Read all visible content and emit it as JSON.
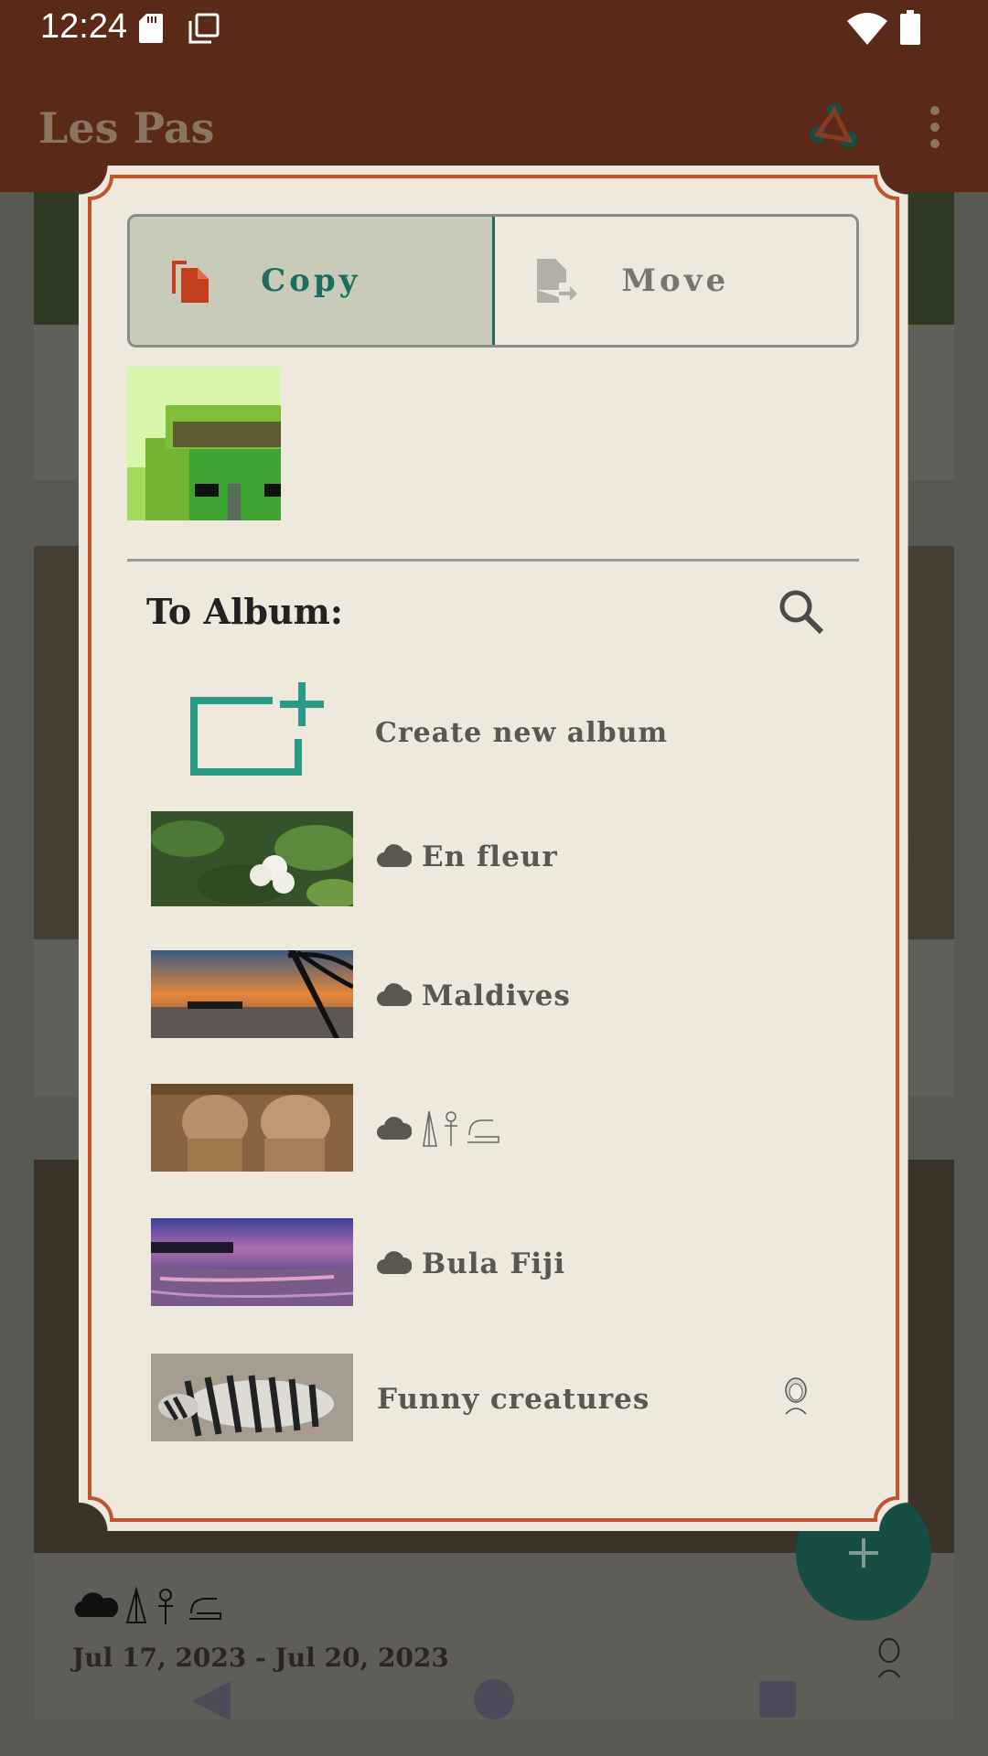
{
  "status_bar": {
    "time": "12:24"
  },
  "app_bar": {
    "title": "Les Pas"
  },
  "background": {
    "date_range": "Jul 17, 2023  -  Jul 20, 2023"
  },
  "dialog": {
    "copy_label": "Copy",
    "move_label": "Move",
    "selected_mode": "Copy",
    "to_album_label": "To Album:",
    "create_new_album_label": "Create new album",
    "albums": [
      {
        "name": "En fleur",
        "cloud": true
      },
      {
        "name": "Maldives",
        "cloud": true
      },
      {
        "name": "",
        "cloud": true,
        "glyphs": "egyptian-hieroglyphs"
      },
      {
        "name": "Bula Fiji",
        "cloud": true
      },
      {
        "name": "Funny creatures",
        "cloud": false,
        "shared_avatar": true
      }
    ]
  },
  "colors": {
    "bar": "#5b2917",
    "dialog_bg": "#efe8dc",
    "frame": "#c4522e",
    "accent": "#1d6c5c",
    "copy_icon": "#c4401c"
  }
}
